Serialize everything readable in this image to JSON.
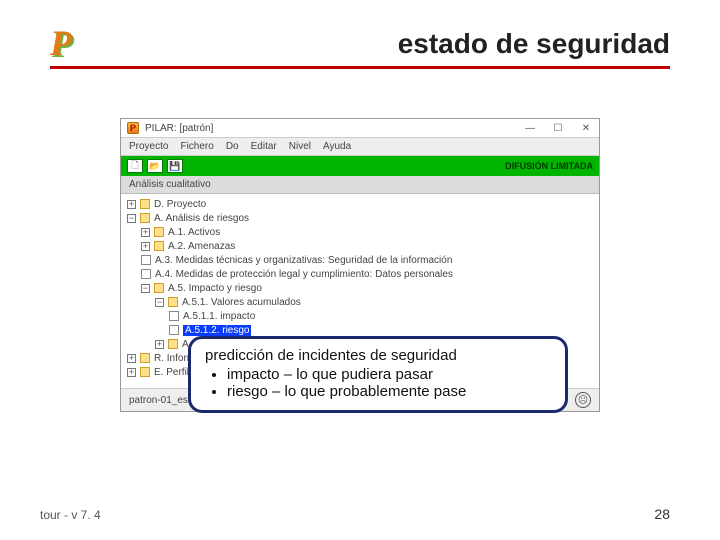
{
  "slide": {
    "title": "estado de seguridad",
    "footer_left": "tour - v 7. 4",
    "page_number": "28"
  },
  "app": {
    "window_title": "PILAR: [patrón]",
    "menu": [
      "Proyecto",
      "Fichero",
      "Do",
      "Editar",
      "Nivel",
      "Ayuda"
    ],
    "toolbar_right": "DIFUSIÓN LIMITADA",
    "pane_header": "Análisis cualitativo",
    "tree": {
      "d": "D. Proyecto",
      "a": "A. Análisis de riesgos",
      "a1": "A.1. Activos",
      "a2": "A.2. Amenazas",
      "a3": "A.3. Medidas técnicas y organizativas: Seguridad de la información",
      "a4": "A.4. Medidas de protección legal y cumplimiento: Datos personales",
      "a5": "A.5. Impacto y riesgo",
      "a51": "A.5.1. Valores acumulados",
      "a511": "A.5.1.1. impacto",
      "a512": "A.5.1.2. riesgo",
      "a52": "A.5.2. Valores repercutidos",
      "r": "R. Informes",
      "e": "E. Perfiles de seguridad"
    },
    "status_file": "patron-01_es.mgr"
  },
  "callout": {
    "title": "predicción de incidentes de seguridad",
    "b1": "impacto – lo que pudiera pasar",
    "b2": "riesgo – lo que probablemente pase"
  }
}
